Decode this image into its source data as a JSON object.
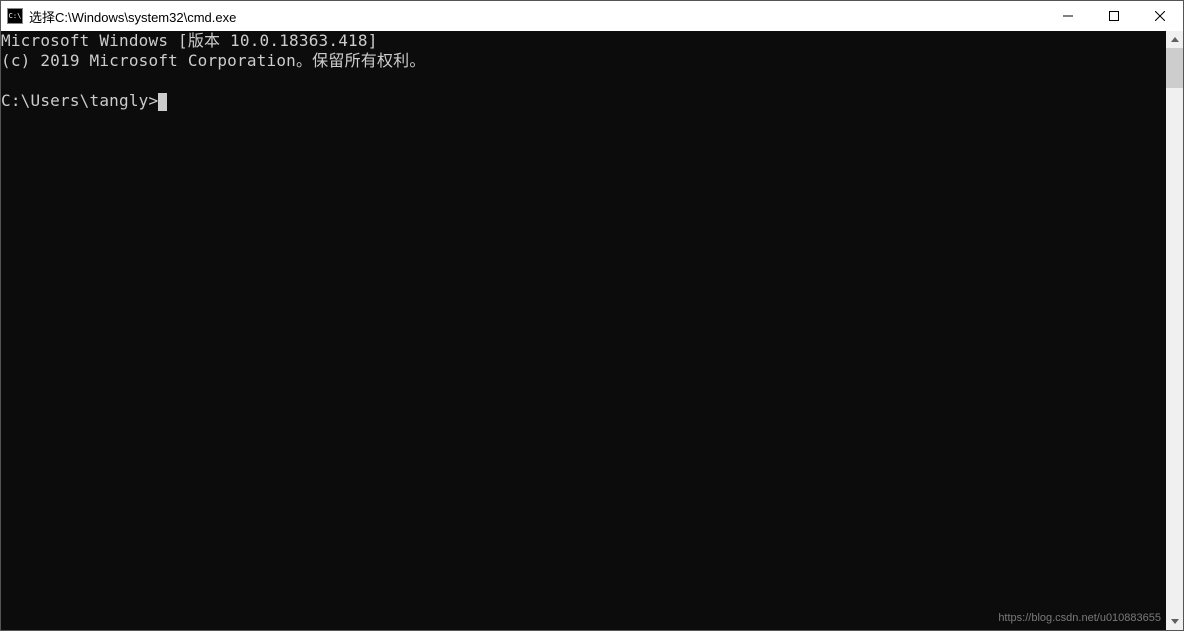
{
  "titlebar": {
    "icon_label": "C:\\",
    "title": "选择C:\\Windows\\system32\\cmd.exe"
  },
  "terminal": {
    "line1": "Microsoft Windows [版本 10.0.18363.418]",
    "line2": "(c) 2019 Microsoft Corporation。保留所有权利。",
    "blank": "",
    "prompt": "C:\\Users\\tangly>"
  },
  "watermark": "https://blog.csdn.net/u010883655"
}
